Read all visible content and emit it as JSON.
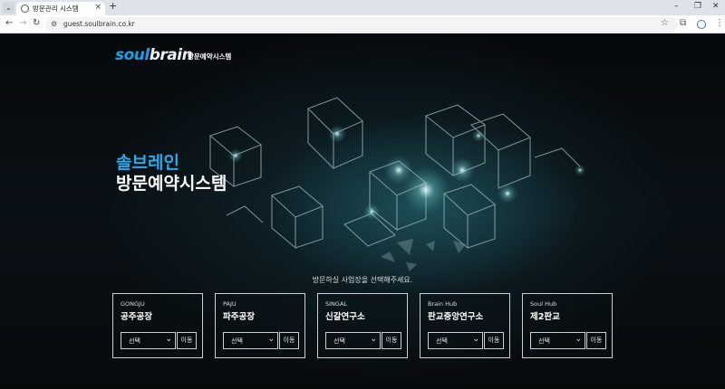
{
  "browser": {
    "tab_title": "방문관리 시스템",
    "tab_close": "×",
    "new_tab": "+",
    "url": "guest.soulbrain.co.kr",
    "icons": {
      "tab_menu": "chevron-down-icon",
      "favicon": "globe-icon",
      "back": "back-arrow-icon",
      "forward": "forward-arrow-icon",
      "reload": "reload-icon",
      "site_info": "site-settings-icon",
      "bookmark": "star-icon",
      "extensions": "puzzle-icon",
      "profile": "profile-icon",
      "menu": "kebab-menu-icon"
    }
  },
  "header": {
    "logo_soul": "soul",
    "logo_brain": "brain",
    "logo_sub": "방문예약시스템",
    "brand_colors": {
      "soul": "#1aa0e8",
      "brain": "#e8eef3"
    }
  },
  "hero": {
    "line1": "솔브레인",
    "line2": "방문예약시스템",
    "accent": "#2ba8ea"
  },
  "sites": {
    "prompt": "방문하실 사업장을 선택해주세요.",
    "items": [
      {
        "en": "GONGJU",
        "ko": "공주공장",
        "select": "선택",
        "go": "이동"
      },
      {
        "en": "PAJU",
        "ko": "파주공장",
        "select": "선택",
        "go": "이동"
      },
      {
        "en": "SINGAL",
        "ko": "신갈연구소",
        "select": "선택",
        "go": "이동"
      },
      {
        "en": "Brain Hub",
        "ko": "판교중앙연구소",
        "select": "선택",
        "go": "이동"
      },
      {
        "en": "Soul Hub",
        "ko": "제2판교",
        "select": "선택",
        "go": "이동"
      }
    ]
  }
}
